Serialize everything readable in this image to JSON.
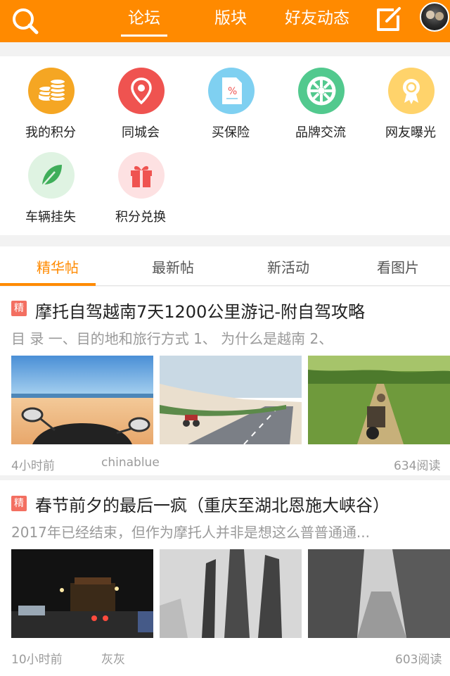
{
  "header": {
    "tabs": [
      "论坛",
      "版块",
      "好友动态"
    ],
    "active_tab": 0,
    "accent": "#ff8a00"
  },
  "quick_links": [
    {
      "label": "我的积分",
      "icon": "coins-icon",
      "color": "#f5a623"
    },
    {
      "label": "同城会",
      "icon": "location-pin-icon",
      "color": "#ef5350"
    },
    {
      "label": "买保险",
      "icon": "document-icon",
      "color": "#7fd0f1"
    },
    {
      "label": "品牌交流",
      "icon": "wheel-icon",
      "color": "#52c98e"
    },
    {
      "label": "网友曝光",
      "icon": "award-icon",
      "color": "#ffd36b"
    },
    {
      "label": "车辆挂失",
      "icon": "leaf-icon",
      "color": "#dff3e2"
    },
    {
      "label": "积分兑换",
      "icon": "gift-icon",
      "color": "#fde1e2"
    }
  ],
  "content_tabs": [
    "精华帖",
    "最新帖",
    "新活动",
    "看图片"
  ],
  "posts": [
    {
      "badge": "精",
      "title": "摩托自驾越南7天1200公里游记-附自驾攻略",
      "excerpt": "目  录  一、目的地和旅行方式  1、         为什么是越南  2、",
      "time": "4小时前",
      "author": "chinablue",
      "reads": "634阅读"
    },
    {
      "badge": "精",
      "title": "春节前夕的最后一疯（重庆至湖北恩施大峡谷）",
      "excerpt": "2017年已经结束，但作为摩托人并非是想这么普普通通...",
      "time": "10小时前",
      "author": "灰灰",
      "reads": "603阅读"
    }
  ]
}
